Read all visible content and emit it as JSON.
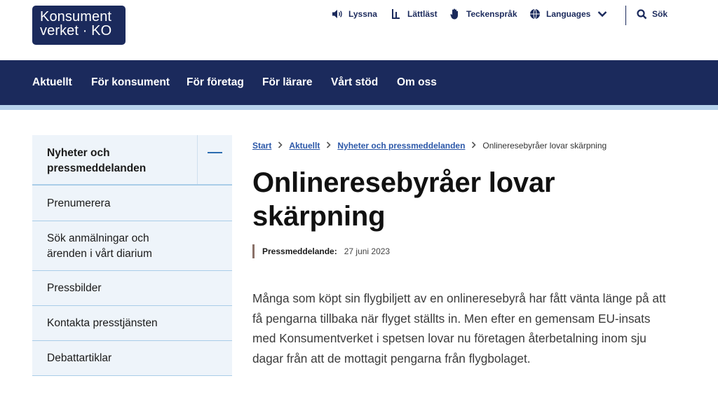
{
  "logo": {
    "line1": "Konsument",
    "line2": "verket · KO"
  },
  "utility": {
    "listen": {
      "label": "Lyssna",
      "icon": "speaker-icon"
    },
    "easy_read": {
      "label": "Lättläst",
      "icon": "easy-read-icon"
    },
    "sign_language": {
      "label": "Teckenspråk",
      "icon": "sign-language-hand-icon"
    },
    "languages": {
      "label": "Languages",
      "icon": "globe-icon"
    },
    "search": {
      "label": "Sök",
      "icon": "search-icon"
    }
  },
  "nav": {
    "items": [
      {
        "label": "Aktuellt"
      },
      {
        "label": "För konsument"
      },
      {
        "label": "För företag"
      },
      {
        "label": "För lärare"
      },
      {
        "label": "Vårt stöd"
      },
      {
        "label": "Om oss"
      }
    ]
  },
  "sidebar": {
    "heading": "Nyheter och pressmeddelanden",
    "items": [
      {
        "label": "Prenumerera"
      },
      {
        "label": "Sök anmälningar och ärenden i vårt diarium"
      },
      {
        "label": "Pressbilder"
      },
      {
        "label": "Kontakta presstjänsten"
      },
      {
        "label": "Debattartiklar"
      }
    ]
  },
  "breadcrumb": {
    "items": [
      {
        "label": "Start"
      },
      {
        "label": "Aktuellt"
      },
      {
        "label": "Nyheter och pressmeddelanden"
      }
    ],
    "current": "Onlineresebyråer lovar skärpning"
  },
  "article": {
    "title": "Onlineresebyråer lovar skärpning",
    "type_label": "Pressmeddelande:",
    "date": "27 juni 2023",
    "lead": "Många som köpt sin flygbiljett av en onlineresebyrå har fått vänta länge på att få pengarna tillbaka när flyget ställts in. Men efter en gemensam EU-insats med Konsumentverket i spetsen lovar nu företagen återbetalning inom sju dagar från att de mottagit pengarna från flygbolaget."
  },
  "colors": {
    "brand_navy": "#1b2a5c",
    "accent_light_blue": "#b7d2ec",
    "sidebar_bg": "#eef4fa",
    "link_blue": "#2b57a8"
  }
}
